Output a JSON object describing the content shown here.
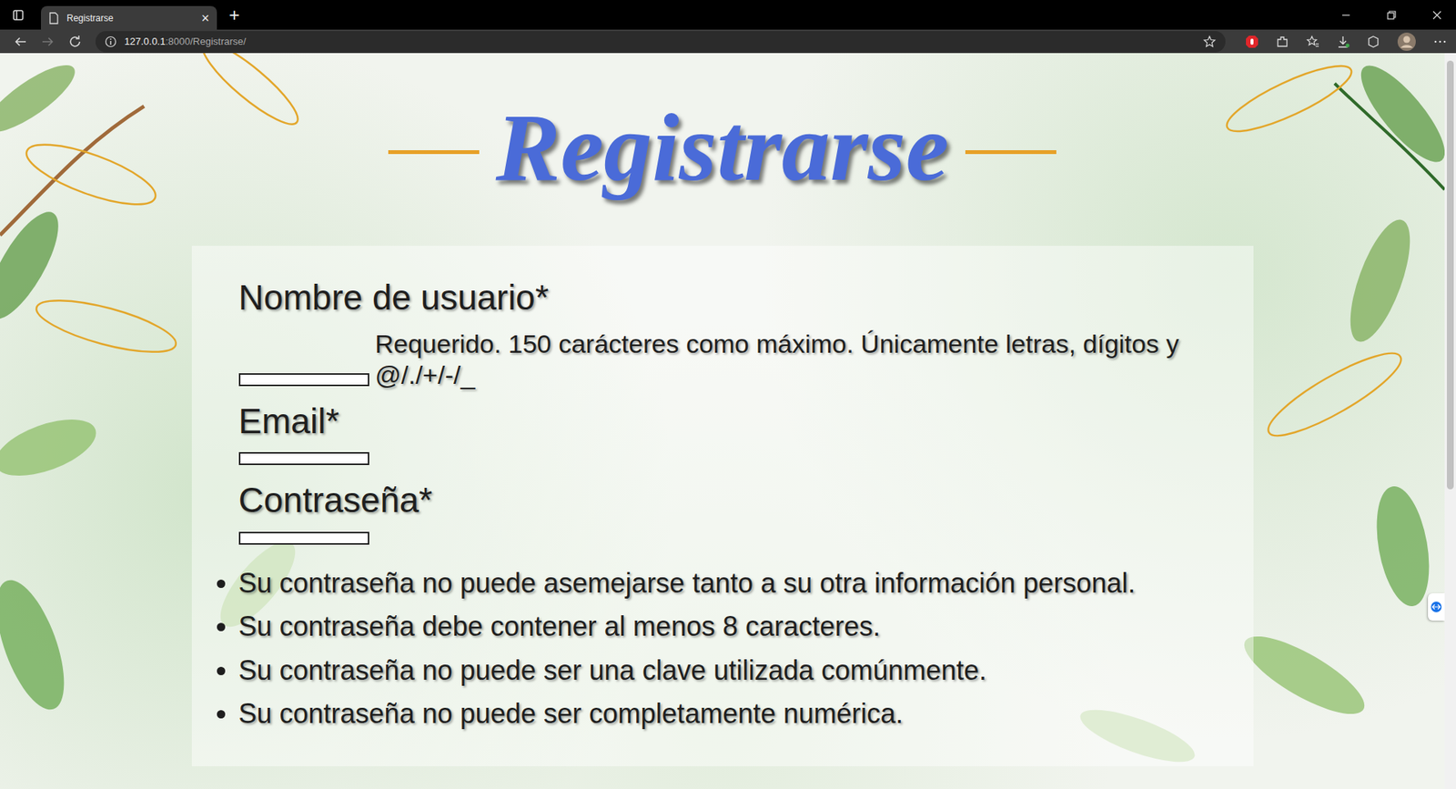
{
  "browser": {
    "tab": {
      "title": "Registrarse",
      "close": "×",
      "selected": true
    },
    "new_tab": "+",
    "url": {
      "host": "127.0.0.1",
      "rest": ":8000/Registrarse/"
    }
  },
  "page": {
    "title": "Registrarse"
  },
  "form": {
    "fields": [
      {
        "label": "Nombre de usuario*",
        "value": "",
        "help": "Requerido. 150 carácteres como máximo. Únicamente letras, dígitos y @/./+/-/_"
      },
      {
        "label": "Email*",
        "value": ""
      },
      {
        "label": "Contraseña*",
        "value": ""
      }
    ],
    "password_rules": [
      "Su contraseña no puede asemejarse tanto a su otra información personal.",
      "Su contraseña debe contener al menos 8 caracteres.",
      "Su contraseña no puede ser una clave utilizada comúnmente.",
      "Su contraseña no puede ser completamente numérica."
    ]
  }
}
